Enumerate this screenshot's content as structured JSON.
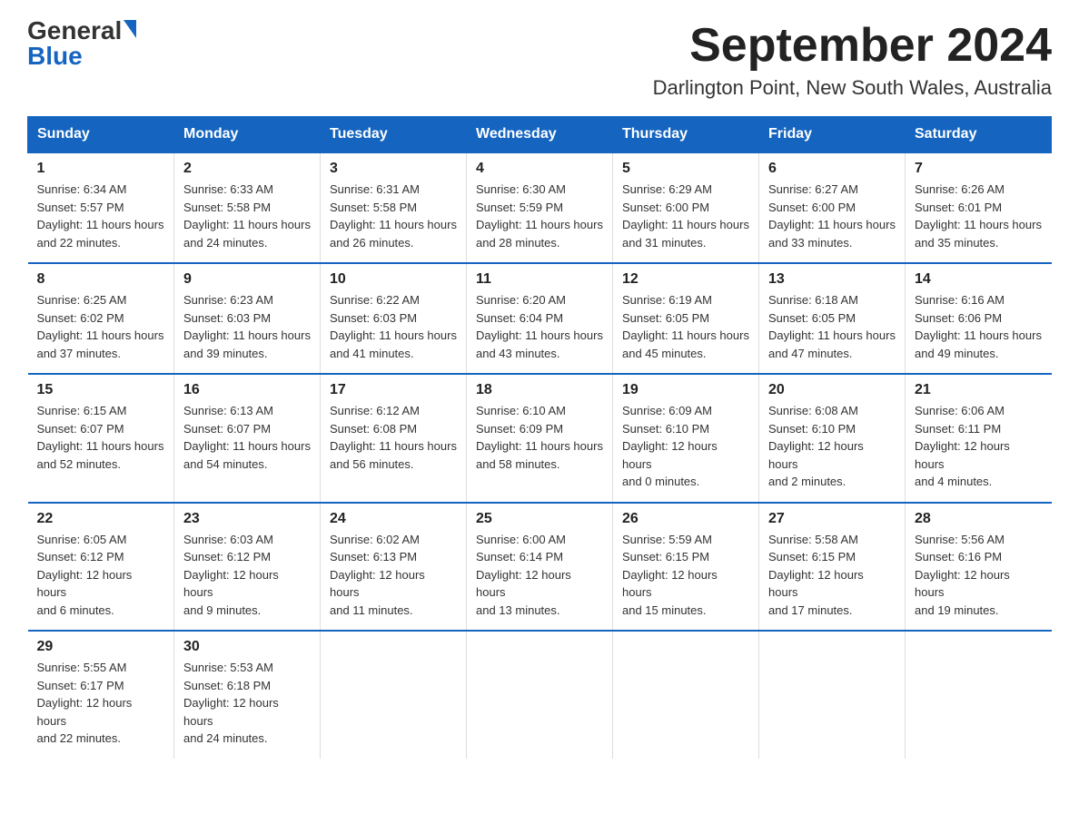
{
  "logo": {
    "general": "General",
    "triangle": "▶",
    "blue": "Blue"
  },
  "title": {
    "month_year": "September 2024",
    "location": "Darlington Point, New South Wales, Australia"
  },
  "days_of_week": [
    "Sunday",
    "Monday",
    "Tuesday",
    "Wednesday",
    "Thursday",
    "Friday",
    "Saturday"
  ],
  "weeks": [
    [
      {
        "day": "1",
        "sunrise": "6:34 AM",
        "sunset": "5:57 PM",
        "daylight": "11 hours and 22 minutes."
      },
      {
        "day": "2",
        "sunrise": "6:33 AM",
        "sunset": "5:58 PM",
        "daylight": "11 hours and 24 minutes."
      },
      {
        "day": "3",
        "sunrise": "6:31 AM",
        "sunset": "5:58 PM",
        "daylight": "11 hours and 26 minutes."
      },
      {
        "day": "4",
        "sunrise": "6:30 AM",
        "sunset": "5:59 PM",
        "daylight": "11 hours and 28 minutes."
      },
      {
        "day": "5",
        "sunrise": "6:29 AM",
        "sunset": "6:00 PM",
        "daylight": "11 hours and 31 minutes."
      },
      {
        "day": "6",
        "sunrise": "6:27 AM",
        "sunset": "6:00 PM",
        "daylight": "11 hours and 33 minutes."
      },
      {
        "day": "7",
        "sunrise": "6:26 AM",
        "sunset": "6:01 PM",
        "daylight": "11 hours and 35 minutes."
      }
    ],
    [
      {
        "day": "8",
        "sunrise": "6:25 AM",
        "sunset": "6:02 PM",
        "daylight": "11 hours and 37 minutes."
      },
      {
        "day": "9",
        "sunrise": "6:23 AM",
        "sunset": "6:03 PM",
        "daylight": "11 hours and 39 minutes."
      },
      {
        "day": "10",
        "sunrise": "6:22 AM",
        "sunset": "6:03 PM",
        "daylight": "11 hours and 41 minutes."
      },
      {
        "day": "11",
        "sunrise": "6:20 AM",
        "sunset": "6:04 PM",
        "daylight": "11 hours and 43 minutes."
      },
      {
        "day": "12",
        "sunrise": "6:19 AM",
        "sunset": "6:05 PM",
        "daylight": "11 hours and 45 minutes."
      },
      {
        "day": "13",
        "sunrise": "6:18 AM",
        "sunset": "6:05 PM",
        "daylight": "11 hours and 47 minutes."
      },
      {
        "day": "14",
        "sunrise": "6:16 AM",
        "sunset": "6:06 PM",
        "daylight": "11 hours and 49 minutes."
      }
    ],
    [
      {
        "day": "15",
        "sunrise": "6:15 AM",
        "sunset": "6:07 PM",
        "daylight": "11 hours and 52 minutes."
      },
      {
        "day": "16",
        "sunrise": "6:13 AM",
        "sunset": "6:07 PM",
        "daylight": "11 hours and 54 minutes."
      },
      {
        "day": "17",
        "sunrise": "6:12 AM",
        "sunset": "6:08 PM",
        "daylight": "11 hours and 56 minutes."
      },
      {
        "day": "18",
        "sunrise": "6:10 AM",
        "sunset": "6:09 PM",
        "daylight": "11 hours and 58 minutes."
      },
      {
        "day": "19",
        "sunrise": "6:09 AM",
        "sunset": "6:10 PM",
        "daylight": "12 hours and 0 minutes."
      },
      {
        "day": "20",
        "sunrise": "6:08 AM",
        "sunset": "6:10 PM",
        "daylight": "12 hours and 2 minutes."
      },
      {
        "day": "21",
        "sunrise": "6:06 AM",
        "sunset": "6:11 PM",
        "daylight": "12 hours and 4 minutes."
      }
    ],
    [
      {
        "day": "22",
        "sunrise": "6:05 AM",
        "sunset": "6:12 PM",
        "daylight": "12 hours and 6 minutes."
      },
      {
        "day": "23",
        "sunrise": "6:03 AM",
        "sunset": "6:12 PM",
        "daylight": "12 hours and 9 minutes."
      },
      {
        "day": "24",
        "sunrise": "6:02 AM",
        "sunset": "6:13 PM",
        "daylight": "12 hours and 11 minutes."
      },
      {
        "day": "25",
        "sunrise": "6:00 AM",
        "sunset": "6:14 PM",
        "daylight": "12 hours and 13 minutes."
      },
      {
        "day": "26",
        "sunrise": "5:59 AM",
        "sunset": "6:15 PM",
        "daylight": "12 hours and 15 minutes."
      },
      {
        "day": "27",
        "sunrise": "5:58 AM",
        "sunset": "6:15 PM",
        "daylight": "12 hours and 17 minutes."
      },
      {
        "day": "28",
        "sunrise": "5:56 AM",
        "sunset": "6:16 PM",
        "daylight": "12 hours and 19 minutes."
      }
    ],
    [
      {
        "day": "29",
        "sunrise": "5:55 AM",
        "sunset": "6:17 PM",
        "daylight": "12 hours and 22 minutes."
      },
      {
        "day": "30",
        "sunrise": "5:53 AM",
        "sunset": "6:18 PM",
        "daylight": "12 hours and 24 minutes."
      },
      null,
      null,
      null,
      null,
      null
    ]
  ],
  "labels": {
    "sunrise": "Sunrise:",
    "sunset": "Sunset:",
    "daylight": "Daylight:"
  }
}
